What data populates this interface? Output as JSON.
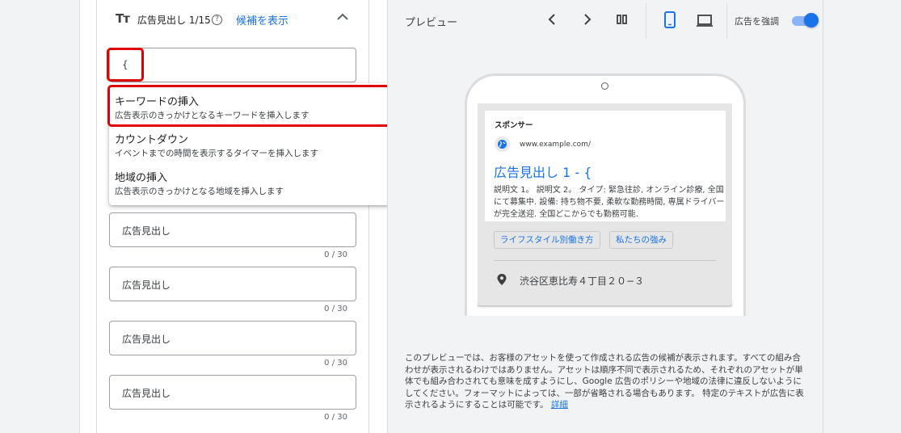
{
  "headline_section": {
    "icon": "Tт",
    "title": "広告見出し 1/15",
    "help_icon": "?",
    "suggestions_link": "候補を表示"
  },
  "active_input": {
    "value": "{"
  },
  "dropdown": {
    "items": [
      {
        "title": "キーワードの挿入",
        "desc": "広告表示のきっかけとなるキーワードを挿入します"
      },
      {
        "title": "カウントダウン",
        "desc": "イベントまでの時間を表示するタイマーを挿入します"
      },
      {
        "title": "地域の挿入",
        "desc": "広告表示のきっかけとなる地域を挿入します"
      }
    ]
  },
  "headline_inputs": [
    {
      "placeholder": "広告見出し",
      "counter": "0 / 30"
    },
    {
      "placeholder": "広告見出し",
      "counter": "0 / 30"
    },
    {
      "placeholder": "広告見出し",
      "counter": "0 / 30"
    },
    {
      "placeholder": "広告見出し",
      "counter": "0 / 30"
    }
  ],
  "preview": {
    "label": "プレビュー",
    "emphasize_label": "広告を強調",
    "emphasize_on": true,
    "sponsor": "スポンサー",
    "url": "www.example.com/",
    "headline": "広告見出し 1 - {",
    "description": "説明文 1。 説明文 2。 タイプ: 緊急往診, オンライン診療, 全国にて募集中. 設備: 持ち物不要, 柔軟な勤務時間, 専属ドライバーが完全送迎. 全国どこからでも勤務可能.",
    "sitelinks": [
      "ライフスタイル別働き方",
      "私たちの強み"
    ],
    "address": "渋谷区恵比寿４丁目２０−３"
  },
  "disclaimer": {
    "text": "このプレビューでは、お客様のアセットを使って作成される広告の候補が表示されます。すべての組み合わせが表示されるわけではありません。アセットは順序不同で表示されるため、それぞれのアセットが単体でも組み合わされても意味を成すようにし、Google 広告のポリシーや地域の法律に違反しないようにしてください。フォーマットによっては、一部が省略される場合もあります。 特定のテキストが広告に表示されるようにすることは可能です。",
    "link": "詳細"
  },
  "colors": {
    "accent": "#1a73e8",
    "highlight_red": "#e00000"
  }
}
